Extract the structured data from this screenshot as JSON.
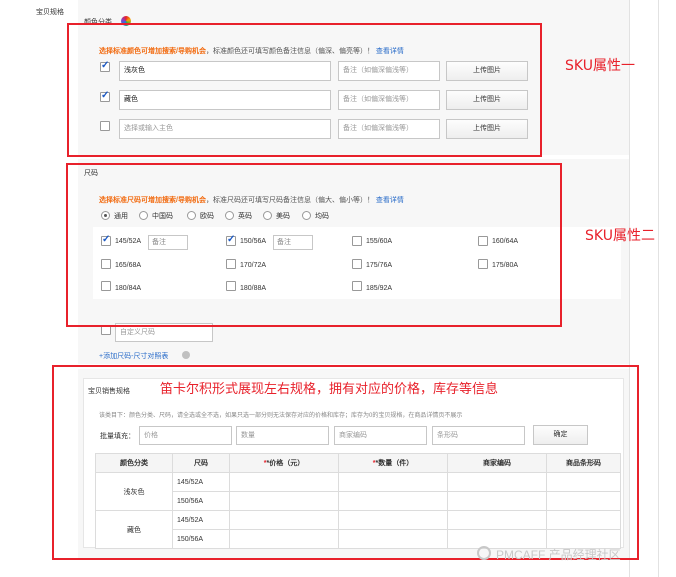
{
  "section": {
    "label": "宝贝规格"
  },
  "color": {
    "title": "颜色分类",
    "tip_bold": "选择标准颜色可增加搜索/导购机会",
    "tip_text": "，标准颜色还可填写颜色备注信息（偏深、偏亮等）！",
    "tip_link": "查看详情",
    "rows": [
      {
        "name": "浅灰色",
        "checked": true,
        "remark_placeholder": "备注（如偏深偏浅等）",
        "upload": "上传图片"
      },
      {
        "name": "藏色",
        "checked": true,
        "remark_placeholder": "备注（如偏深偏浅等）",
        "upload": "上传图片"
      },
      {
        "name": "选择或输入主色",
        "checked": false,
        "remark_placeholder": "备注（如偏深偏浅等）",
        "upload": "上传图片"
      }
    ]
  },
  "size": {
    "title": "尺码",
    "tip_bold": "选择标准尺码可增加搜索/导购机会",
    "tip_text": "，标准尺码还可填写尺码备注信息（偏大、偏小等）！",
    "tip_link": "查看详情",
    "types": [
      "通用",
      "中国码",
      "欧码",
      "英码",
      "美码",
      "均码"
    ],
    "selected_type": "通用",
    "items": [
      {
        "label": "145/52A",
        "checked": true,
        "note": "备注"
      },
      {
        "label": "150/56A",
        "checked": true,
        "note": "备注"
      },
      {
        "label": "155/60A",
        "checked": false
      },
      {
        "label": "160/64A",
        "checked": false
      },
      {
        "label": "165/68A",
        "checked": false
      },
      {
        "label": "170/72A",
        "checked": false
      },
      {
        "label": "175/76A",
        "checked": false
      },
      {
        "label": "175/80A",
        "checked": false
      },
      {
        "label": "180/84A",
        "checked": false
      },
      {
        "label": "180/88A",
        "checked": false
      },
      {
        "label": "185/92A",
        "checked": false
      }
    ],
    "custom_placeholder": "自定义尺码",
    "add_link": "+添加尺码-尺寸对照表"
  },
  "sales": {
    "title": "宝贝销售规格",
    "hint": "该类目下：颜色分类、尺码，请全选或全不选，如果只选一部分则无法保存对应的价格和库存；库存为0的宝贝规格，在商品详情页不展示",
    "batch_label": "批量填充：",
    "batch_fields": [
      "价格",
      "数量",
      "商家编码",
      "条形码"
    ],
    "confirm": "确定",
    "columns": [
      "颜色分类",
      "尺码",
      "*价格（元）",
      "*数量（件）",
      "商家编码",
      "商品条形码"
    ],
    "rows": [
      {
        "color": "浅灰色",
        "sizes": [
          "145/52A",
          "150/56A"
        ]
      },
      {
        "color": "藏色",
        "sizes": [
          "145/52A",
          "150/56A"
        ]
      }
    ]
  },
  "annotations": {
    "sku1": "SKU属性一",
    "sku2": "SKU属性二",
    "cartesian": "笛卡尔积形式展现左右规格，拥有对应的价格，库存等信息"
  },
  "watermark": "PMCAFF 产品经理社区",
  "accent_colors": {
    "annotation_red": "#e8212b",
    "tip_orange": "#f26c12",
    "link_blue": "#2a6cc9"
  }
}
